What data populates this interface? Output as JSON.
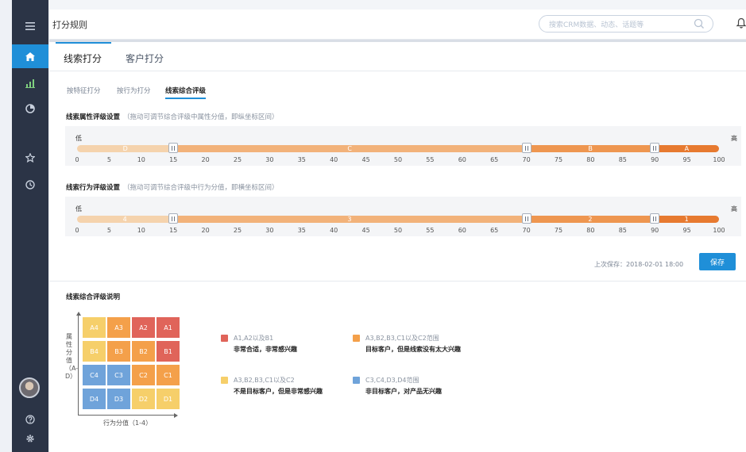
{
  "header": {
    "title": "打分规则",
    "search_placeholder": "搜索CRM数据、动态、话题等"
  },
  "main_tabs": [
    {
      "label": "线索打分",
      "active": true
    },
    {
      "label": "客户打分",
      "active": false
    }
  ],
  "sub_tabs": [
    {
      "label": "按特征打分",
      "active": false
    },
    {
      "label": "按行为打分",
      "active": false
    },
    {
      "label": "线索综合评级",
      "active": true
    }
  ],
  "attribute_section": {
    "title": "线索属性评级设置",
    "hint": "（拖动可调节综合评级中属性分值，即纵坐标区间）",
    "low_label": "低",
    "high_label": "高",
    "segments": [
      {
        "label": "D",
        "from": 0,
        "to": 15,
        "color": "#f5d3ad"
      },
      {
        "label": "C",
        "from": 15,
        "to": 70,
        "color": "#f2b27a"
      },
      {
        "label": "B",
        "from": 70,
        "to": 90,
        "color": "#ee9650"
      },
      {
        "label": "A",
        "from": 90,
        "to": 100,
        "color": "#e77a30"
      }
    ],
    "handles": [
      15,
      70,
      90
    ],
    "ticks": [
      "0",
      "5",
      "10",
      "15",
      "20",
      "25",
      "30",
      "35",
      "40",
      "45",
      "50",
      "55",
      "60",
      "65",
      "70",
      "75",
      "80",
      "85",
      "90",
      "95",
      "100"
    ]
  },
  "behavior_section": {
    "title": "线索行为评级设置",
    "hint": "（拖动可调节综合评级中行为分值，即横坐标区间）",
    "low_label": "低",
    "high_label": "高",
    "segments": [
      {
        "label": "4",
        "from": 0,
        "to": 15,
        "color": "#f5d3ad"
      },
      {
        "label": "3",
        "from": 15,
        "to": 70,
        "color": "#f2b27a"
      },
      {
        "label": "2",
        "from": 70,
        "to": 90,
        "color": "#ee9650"
      },
      {
        "label": "1",
        "from": 90,
        "to": 100,
        "color": "#e77a30"
      }
    ],
    "handles": [
      15,
      70,
      90
    ],
    "ticks": [
      "0",
      "5",
      "10",
      "15",
      "20",
      "25",
      "30",
      "35",
      "40",
      "45",
      "50",
      "55",
      "60",
      "65",
      "70",
      "75",
      "80",
      "85",
      "90",
      "95",
      "100"
    ]
  },
  "save_area": {
    "last_saved": "上次保存：2018-02-01 18:00",
    "save_label": "保存"
  },
  "explain": {
    "title": "线索综合评级说明",
    "y_axis_label": "属性分值（A-D）",
    "x_axis_label": "行为分值（1-4）",
    "grid": [
      [
        {
          "label": "A4",
          "tone": "yellow"
        },
        {
          "label": "A3",
          "tone": "orange"
        },
        {
          "label": "A2",
          "tone": "red"
        },
        {
          "label": "A1",
          "tone": "red"
        }
      ],
      [
        {
          "label": "B4",
          "tone": "yellow"
        },
        {
          "label": "B3",
          "tone": "orange"
        },
        {
          "label": "B2",
          "tone": "orange"
        },
        {
          "label": "B1",
          "tone": "red"
        }
      ],
      [
        {
          "label": "C4",
          "tone": "blue"
        },
        {
          "label": "C3",
          "tone": "blue"
        },
        {
          "label": "C2",
          "tone": "orange"
        },
        {
          "label": "C1",
          "tone": "orange"
        }
      ],
      [
        {
          "label": "D4",
          "tone": "blue"
        },
        {
          "label": "D3",
          "tone": "blue"
        },
        {
          "label": "D2",
          "tone": "yellow"
        },
        {
          "label": "D1",
          "tone": "yellow"
        }
      ]
    ],
    "legend": [
      {
        "title": "A1,A2以及B1",
        "desc": "非常合适，非常感兴趣",
        "color": "#e0645a"
      },
      {
        "title": "A3,B2,B3,C1以及C2范围",
        "desc": "目标客户，但是线索没有太大兴趣",
        "color": "#f4a04a"
      },
      {
        "title": "A3,B2,B3,C1以及C2",
        "desc": "不是目标客户，但是非常感兴趣",
        "color": "#f6cf6a"
      },
      {
        "title": "C3,C4,D3,D4范围",
        "desc": "非目标客户，对产品无兴趣",
        "color": "#6fa3da"
      }
    ]
  },
  "sidebar": {
    "items": [
      {
        "icon": "menu-icon"
      },
      {
        "icon": "home-icon",
        "active": true
      },
      {
        "icon": "bar-chart-icon"
      },
      {
        "icon": "pie-chart-icon"
      },
      {
        "icon": "star-icon"
      },
      {
        "icon": "history-icon"
      },
      {
        "icon": "help-icon"
      },
      {
        "icon": "settings-icon"
      }
    ]
  }
}
